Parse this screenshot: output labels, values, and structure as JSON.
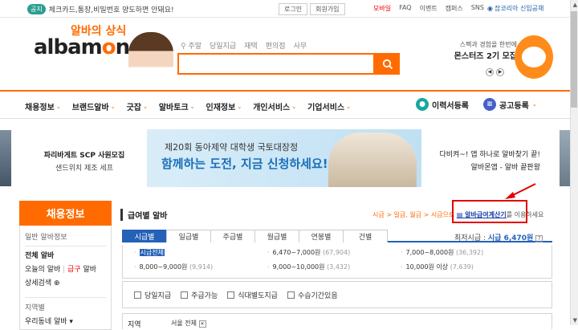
{
  "topbar": {
    "notice_badge": "공지",
    "notice_text": "체크카드,통장,비밀번호 양도하면 안돼요!",
    "links": [
      "로그인",
      "회원가입"
    ],
    "links2": [
      "모바일",
      "FAQ",
      "이벤트",
      "캠퍼스",
      "SNS"
    ],
    "japan": "잡코리아 신입공채"
  },
  "header": {
    "slogan": "알바의 상식",
    "logo_pre": "albam",
    "logo_o": "o",
    "logo_post": "n",
    "keywords": [
      "주말",
      "당일지급",
      "재택",
      "편의점",
      "사무"
    ],
    "promo_sub": "스펙과 경험을 한번에",
    "promo_title": "몬스터즈 2기 모집",
    "brand_color": "#ff6b00"
  },
  "nav": {
    "items": [
      "채용정보",
      "브랜드알바",
      "긋잡",
      "알바토크",
      "인재정보",
      "개인서비스",
      "기업서비스"
    ],
    "resume": "이력서등록",
    "post": "공고등록"
  },
  "banners": {
    "left_t1": "파리바게트 SCP 사원모집",
    "left_t2": "샌드위치 제조 세프",
    "center_t1": "제20회 동아제약 대학생 국토대장정",
    "center_t2": "함께하는 도전, 지금 신청하세요!",
    "right_t1": "다비켜~! 앱 하나로 알바찾기 끝!",
    "right_t2": "알바몬앱 - 알바 끝판왕"
  },
  "sidebar": {
    "title": "채용정보",
    "section1": "일반 알바정보",
    "link_all": "전체 알바",
    "link_today": "오늘의 알바",
    "link_urgent": "급구",
    "link_alba": "알바",
    "link_detail": "상세검색",
    "section2": "지역별",
    "link_nearby": "우리동네 알바"
  },
  "main": {
    "title": "급여별 알바",
    "crumbs_pre": "시급 > 일급, 월급 > 시급으로",
    "calc_link": "알바급여계산기",
    "crumbs_post": "를 이용하세요",
    "tabs": [
      "시급별",
      "일급별",
      "주급별",
      "월급별",
      "연봉별",
      "건별"
    ],
    "min_wage_label": "최저시급 :",
    "min_wage_value": "시급 6,470원",
    "wages": [
      {
        "label": "시급전체",
        "count": ""
      },
      {
        "label": "6,470~7,000원",
        "count": "(67,904)"
      },
      {
        "label": "7,000~8,000원",
        "count": "(36,392)"
      },
      {
        "label": "8,000~9,000원",
        "count": "(9,914)"
      },
      {
        "label": "9,000~10,000원",
        "count": "(3,432)"
      },
      {
        "label": "10,000원 이상",
        "count": "(7,639)"
      }
    ],
    "checks": [
      "당일지급",
      "주급가능",
      "식대별도지급",
      "수습기간있음"
    ],
    "region_label": "지역",
    "region_value": "서울 전체"
  }
}
